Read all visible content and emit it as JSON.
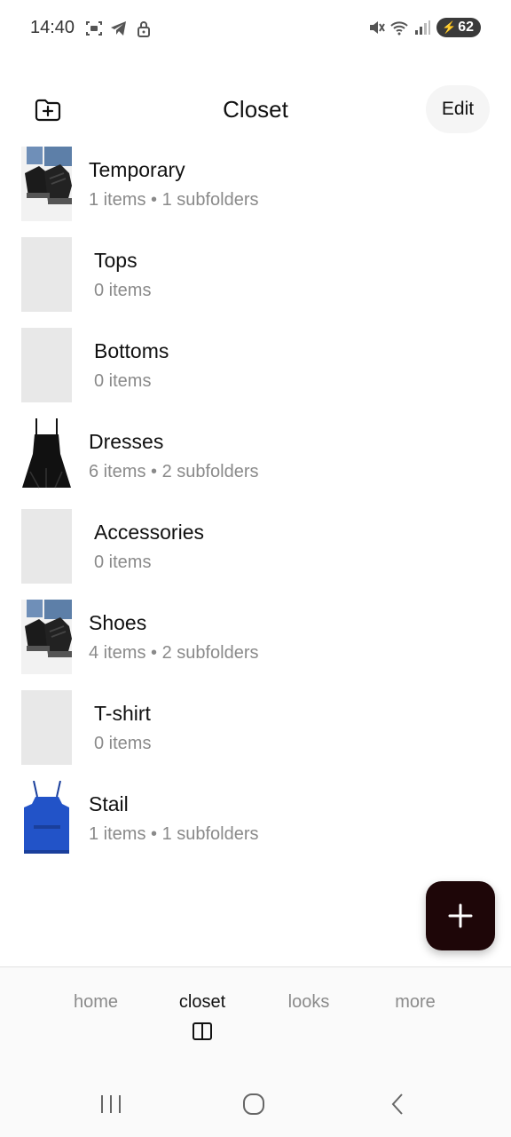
{
  "status_bar": {
    "time": "14:40",
    "battery": "62",
    "left_icons": [
      "screenshot-icon",
      "telegram-icon",
      "lock-icon"
    ],
    "right_icons": [
      "mute-icon",
      "wifi-icon",
      "signal-icon"
    ]
  },
  "header": {
    "title": "Closet",
    "edit_label": "Edit"
  },
  "folders": [
    {
      "name": "Temporary",
      "meta": "1 items • 1 subfolders",
      "thumb": "sneakers"
    },
    {
      "name": "Tops",
      "meta": "0 items",
      "thumb": "none"
    },
    {
      "name": "Bottoms",
      "meta": "0 items",
      "thumb": "none"
    },
    {
      "name": "Dresses",
      "meta": "6 items • 2 subfolders",
      "thumb": "black-dress"
    },
    {
      "name": "Accessories",
      "meta": "0 items",
      "thumb": "none"
    },
    {
      "name": "Shoes",
      "meta": "4 items • 2 subfolders",
      "thumb": "sneakers"
    },
    {
      "name": "T-shirt",
      "meta": "0 items",
      "thumb": "none"
    },
    {
      "name": "Stail",
      "meta": "1 items • 1 subfolders",
      "thumb": "blue-top"
    }
  ],
  "bottom_nav": {
    "tabs": [
      {
        "label": "home"
      },
      {
        "label": "closet"
      },
      {
        "label": "looks"
      },
      {
        "label": "more"
      }
    ],
    "active": "closet"
  },
  "colors": {
    "fab_bg": "#1e0608",
    "muted_text": "#8a8a8a",
    "placeholder_thumb": "#e8e8e8"
  }
}
